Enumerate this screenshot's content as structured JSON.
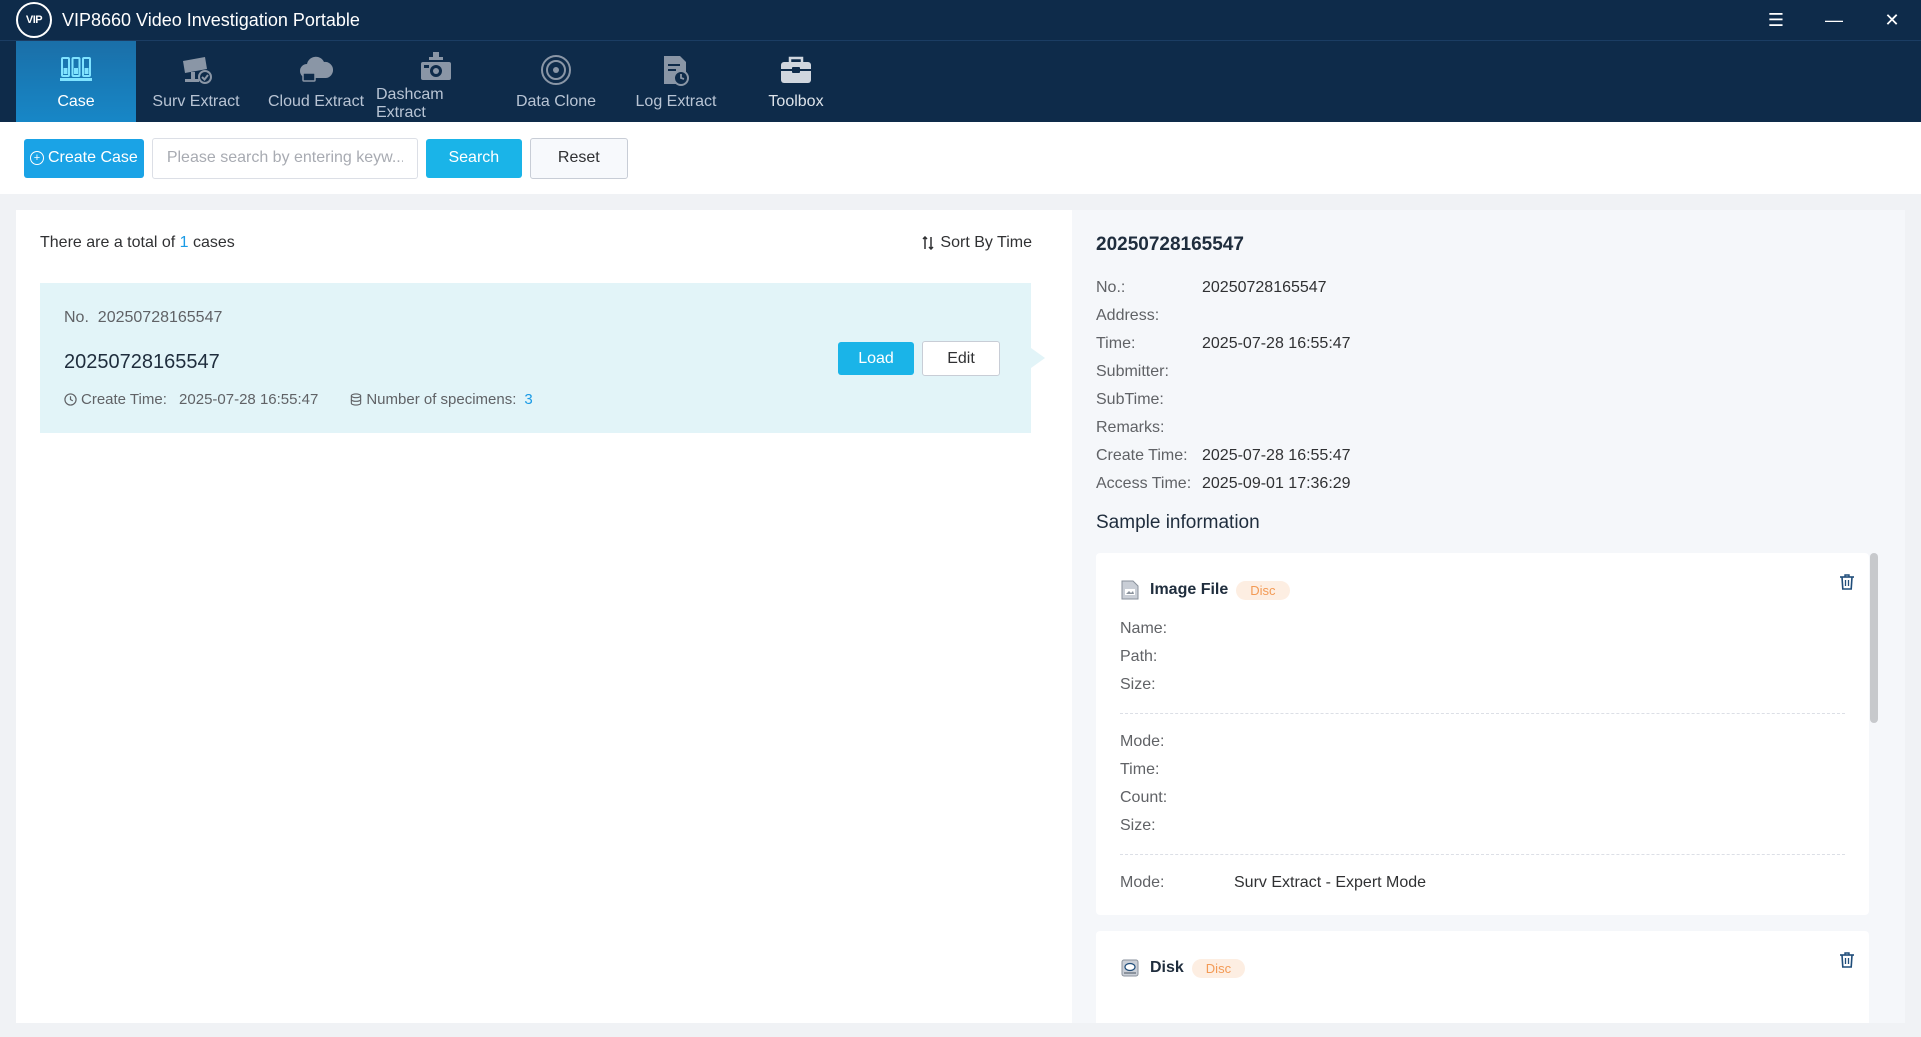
{
  "titlebar": {
    "logo_text": "VIP",
    "title": "VIP8660 Video Investigation Portable",
    "menu_glyph": "☰",
    "minimize_glyph": "—",
    "close_glyph": "✕"
  },
  "nav": {
    "items": [
      {
        "label": "Case",
        "icon": "case-icon",
        "active": true
      },
      {
        "label": "Surv Extract",
        "icon": "surveillance-camera-icon",
        "active": false
      },
      {
        "label": "Cloud Extract",
        "icon": "cloud-icon",
        "active": false
      },
      {
        "label": "Dashcam Extract",
        "icon": "dashcam-icon",
        "active": false
      },
      {
        "label": "Data Clone",
        "icon": "disc-icon",
        "active": false
      },
      {
        "label": "Log Extract",
        "icon": "log-file-icon",
        "active": false
      },
      {
        "label": "Toolbox",
        "icon": "toolbox-icon",
        "active": false
      }
    ]
  },
  "toolbar": {
    "create_label": "Create Case",
    "search_placeholder": "Please search by entering keyw...",
    "search_value": "",
    "search_label": "Search",
    "reset_label": "Reset"
  },
  "case_list": {
    "total_prefix": "There are a total of",
    "total_count": "1",
    "total_suffix": "cases",
    "sort_label": "Sort By Time",
    "cases": [
      {
        "no_label": "No.",
        "no": "20250728165547",
        "name": "20250728165547",
        "create_time_label": "Create Time:",
        "create_time": "2025-07-28 16:55:47",
        "specimens_label": "Number of specimens:",
        "specimens": "3",
        "load_label": "Load",
        "edit_label": "Edit"
      }
    ]
  },
  "detail": {
    "title": "20250728165547",
    "fields": [
      {
        "label": "No.:",
        "value": "20250728165547"
      },
      {
        "label": "Address:",
        "value": ""
      },
      {
        "label": "Time:",
        "value": "2025-07-28 16:55:47"
      },
      {
        "label": "Submitter:",
        "value": ""
      },
      {
        "label": "SubTime:",
        "value": ""
      },
      {
        "label": "Remarks:",
        "value": ""
      },
      {
        "label": "Create Time:",
        "value": "2025-07-28 16:55:47"
      },
      {
        "label": "Access Time:",
        "value": "2025-09-01 17:36:29"
      }
    ],
    "sample_section_title": "Sample information",
    "samples": [
      {
        "name": "Image File",
        "badge": "Disc",
        "icon": "image-file-icon",
        "group1": [
          {
            "label": "Name:",
            "value": ""
          },
          {
            "label": "Path:",
            "value": ""
          },
          {
            "label": "Size:",
            "value": ""
          }
        ],
        "group2": [
          {
            "label": "Mode:",
            "value": ""
          },
          {
            "label": "Time:",
            "value": ""
          },
          {
            "label": "Count:",
            "value": ""
          },
          {
            "label": "Size:",
            "value": ""
          }
        ],
        "group3": [
          {
            "label": "Mode:",
            "value": "Surv Extract - Expert Mode"
          }
        ]
      },
      {
        "name": "Disk",
        "badge": "Disc",
        "icon": "disk-icon"
      }
    ]
  },
  "colors": {
    "header_bg": "#0e2b4a",
    "accent": "#1ab4e8",
    "badge_text": "#f39a55",
    "badge_bg": "#fdeee2"
  }
}
